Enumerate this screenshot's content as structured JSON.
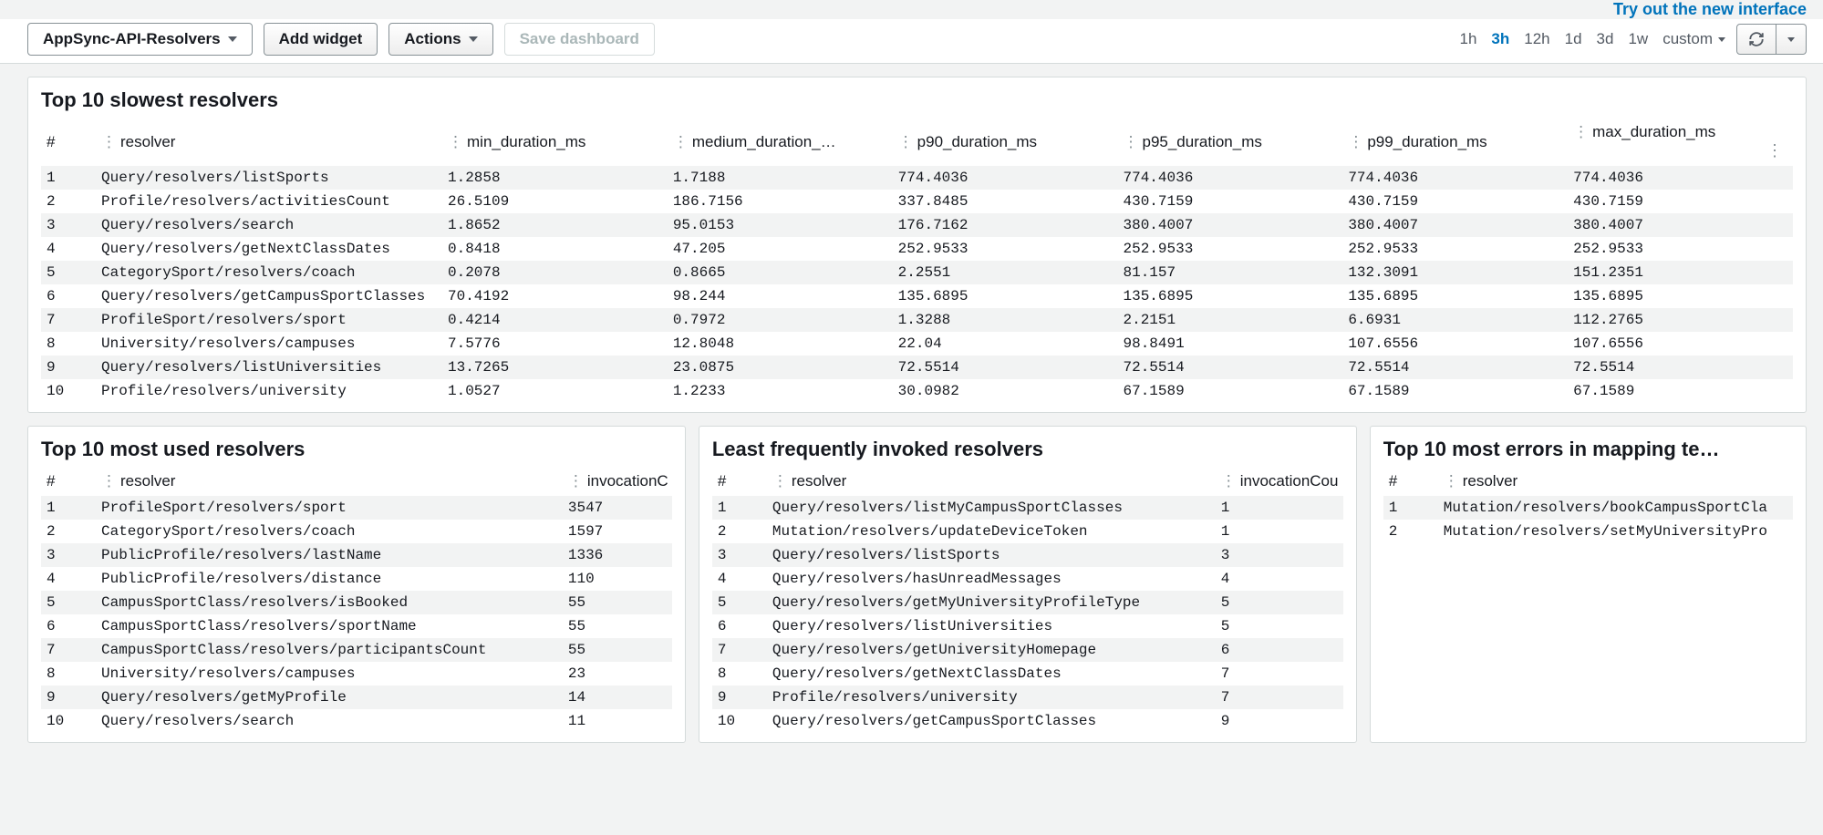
{
  "topLink": "Try out the new interface",
  "toolbar": {
    "dashboardName": "AppSync-API-Resolvers",
    "addWidget": "Add widget",
    "actions": "Actions",
    "saveDashboard": "Save dashboard"
  },
  "timeRange": {
    "options": [
      "1h",
      "3h",
      "12h",
      "1d",
      "3d",
      "1w"
    ],
    "custom": "custom",
    "active": "3h"
  },
  "widgets": {
    "slowest": {
      "title": "Top 10 slowest resolvers",
      "columns": [
        "#",
        "resolver",
        "min_duration_ms",
        "medium_duration_…",
        "p90_duration_ms",
        "p95_duration_ms",
        "p99_duration_ms",
        "max_duration_ms"
      ],
      "rows": [
        [
          "1",
          "Query/resolvers/listSports",
          "1.2858",
          "1.7188",
          "774.4036",
          "774.4036",
          "774.4036",
          "774.4036"
        ],
        [
          "2",
          "Profile/resolvers/activitiesCount",
          "26.5109",
          "186.7156",
          "337.8485",
          "430.7159",
          "430.7159",
          "430.7159"
        ],
        [
          "3",
          "Query/resolvers/search",
          "1.8652",
          "95.0153",
          "176.7162",
          "380.4007",
          "380.4007",
          "380.4007"
        ],
        [
          "4",
          "Query/resolvers/getNextClassDates",
          "0.8418",
          "47.205",
          "252.9533",
          "252.9533",
          "252.9533",
          "252.9533"
        ],
        [
          "5",
          "CategorySport/resolvers/coach",
          "0.2078",
          "0.8665",
          "2.2551",
          "81.157",
          "132.3091",
          "151.2351"
        ],
        [
          "6",
          "Query/resolvers/getCampusSportClasses",
          "70.4192",
          "98.244",
          "135.6895",
          "135.6895",
          "135.6895",
          "135.6895"
        ],
        [
          "7",
          "ProfileSport/resolvers/sport",
          "0.4214",
          "0.7972",
          "1.3288",
          "2.2151",
          "6.6931",
          "112.2765"
        ],
        [
          "8",
          "University/resolvers/campuses",
          "7.5776",
          "12.8048",
          "22.04",
          "98.8491",
          "107.6556",
          "107.6556"
        ],
        [
          "9",
          "Query/resolvers/listUniversities",
          "13.7265",
          "23.0875",
          "72.5514",
          "72.5514",
          "72.5514",
          "72.5514"
        ],
        [
          "10",
          "Profile/resolvers/university",
          "1.0527",
          "1.2233",
          "30.0982",
          "67.1589",
          "67.1589",
          "67.1589"
        ]
      ]
    },
    "mostUsed": {
      "title": "Top 10 most used resolvers",
      "columns": [
        "#",
        "resolver",
        "invocationC"
      ],
      "rows": [
        [
          "1",
          "ProfileSport/resolvers/sport",
          "3547"
        ],
        [
          "2",
          "CategorySport/resolvers/coach",
          "1597"
        ],
        [
          "3",
          "PublicProfile/resolvers/lastName",
          "1336"
        ],
        [
          "4",
          "PublicProfile/resolvers/distance",
          "110"
        ],
        [
          "5",
          "CampusSportClass/resolvers/isBooked",
          "55"
        ],
        [
          "6",
          "CampusSportClass/resolvers/sportName",
          "55"
        ],
        [
          "7",
          "CampusSportClass/resolvers/participantsCount",
          "55"
        ],
        [
          "8",
          "University/resolvers/campuses",
          "23"
        ],
        [
          "9",
          "Query/resolvers/getMyProfile",
          "14"
        ],
        [
          "10",
          "Query/resolvers/search",
          "11"
        ]
      ]
    },
    "leastInvoked": {
      "title": "Least frequently invoked resolvers",
      "columns": [
        "#",
        "resolver",
        "invocationCou"
      ],
      "rows": [
        [
          "1",
          "Query/resolvers/listMyCampusSportClasses",
          "1"
        ],
        [
          "2",
          "Mutation/resolvers/updateDeviceToken",
          "1"
        ],
        [
          "3",
          "Query/resolvers/listSports",
          "3"
        ],
        [
          "4",
          "Query/resolvers/hasUnreadMessages",
          "4"
        ],
        [
          "5",
          "Query/resolvers/getMyUniversityProfileType",
          "5"
        ],
        [
          "6",
          "Query/resolvers/listUniversities",
          "5"
        ],
        [
          "7",
          "Query/resolvers/getUniversityHomepage",
          "6"
        ],
        [
          "8",
          "Query/resolvers/getNextClassDates",
          "7"
        ],
        [
          "9",
          "Profile/resolvers/university",
          "7"
        ],
        [
          "10",
          "Query/resolvers/getCampusSportClasses",
          "9"
        ]
      ]
    },
    "mostErrors": {
      "title": "Top 10 most errors in mapping te…",
      "columns": [
        "#",
        "resolver"
      ],
      "rows": [
        [
          "1",
          "Mutation/resolvers/bookCampusSportCla"
        ],
        [
          "2",
          "Mutation/resolvers/setMyUniversityPro"
        ]
      ]
    }
  }
}
